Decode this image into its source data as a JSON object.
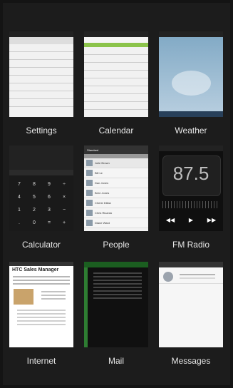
{
  "apps": [
    {
      "label": "Settings"
    },
    {
      "label": "Calendar"
    },
    {
      "label": "Weather"
    },
    {
      "label": "Calculator"
    },
    {
      "label": "People"
    },
    {
      "label": "FM Radio"
    },
    {
      "label": "Internet"
    },
    {
      "label": "Mail"
    },
    {
      "label": "Messages"
    }
  ],
  "calculator": {
    "keys": [
      "7",
      "8",
      "9",
      "÷",
      "4",
      "5",
      "6",
      "×",
      "1",
      "2",
      "3",
      "−",
      ".",
      "0",
      "=",
      "+"
    ]
  },
  "radio": {
    "frequency": "87.5"
  },
  "people": {
    "title": "Standard",
    "names": [
      "Julie Brown",
      "Bill Le",
      "Dan Jones",
      "Bree Jones",
      "Cherie Dillan",
      "Chris Ricardo",
      "Diane Ward"
    ]
  },
  "internet": {
    "headline": "HTC Sales Manager"
  }
}
